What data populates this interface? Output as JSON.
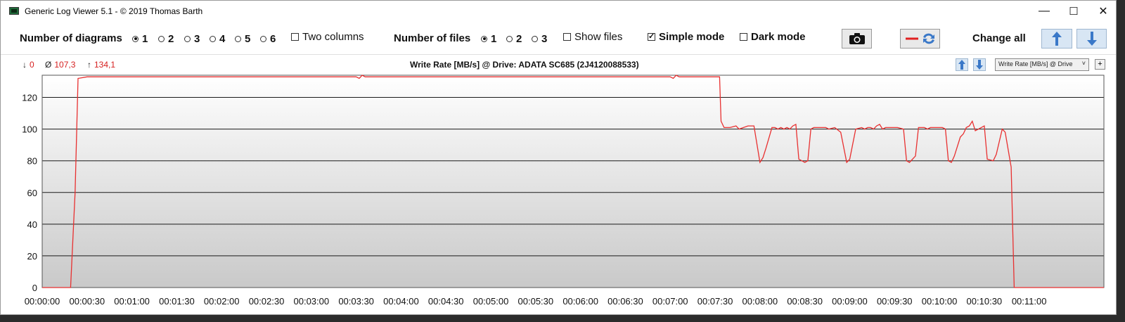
{
  "window": {
    "title": "Generic Log Viewer 5.1 - © 2019 Thomas Barth",
    "minimize_glyph": "—",
    "maximize_glyph": "☐",
    "close_glyph": "✕"
  },
  "toolbar": {
    "diagrams_label": "Number of diagrams",
    "diagram_options": [
      "1",
      "2",
      "3",
      "4",
      "5",
      "6"
    ],
    "diagram_selected": "1",
    "two_columns_label": "Two columns",
    "two_columns_checked": false,
    "files_label": "Number of files",
    "file_options": [
      "1",
      "2",
      "3"
    ],
    "file_selected": "1",
    "show_files_label": "Show files",
    "show_files_checked": false,
    "simple_mode_label": "Simple mode",
    "simple_mode_checked": true,
    "dark_mode_label": "Dark mode",
    "dark_mode_checked": false,
    "check_glyph": "✓",
    "change_all_label": "Change all",
    "icons": {
      "screenshot": "camera-icon",
      "swap": "swap-line-color-icon",
      "up": "arrow-up-icon",
      "down": "arrow-down-icon"
    },
    "accent_red": "#e02020",
    "accent_blue": "#3a78c8"
  },
  "chart_header": {
    "min_symbol": "↓",
    "min_value": "0",
    "avg_symbol": "Ø",
    "avg_value": "107,3",
    "max_symbol": "↑",
    "max_value": "134,1",
    "title": "Write Rate [MB/s] @ Drive: ADATA SC685 (2J4120088533)",
    "series_select_value": "Write Rate [MB/s] @ Drive",
    "series_select_chevron": "˅",
    "add_button": "+"
  },
  "chart_data": {
    "type": "line",
    "title": "Write Rate [MB/s] @ Drive: ADATA SC685 (2J4120088533)",
    "xlabel": "",
    "ylabel": "",
    "ylim": [
      0,
      134
    ],
    "xlim_seconds": [
      0,
      710
    ],
    "grid": true,
    "y_ticks": [
      0,
      20,
      40,
      60,
      80,
      100,
      120
    ],
    "x_ticks": [
      "00:00:00",
      "00:00:30",
      "00:01:00",
      "00:01:30",
      "00:02:00",
      "00:02:30",
      "00:03:00",
      "00:03:30",
      "00:04:00",
      "00:04:30",
      "00:05:00",
      "00:05:30",
      "00:06:00",
      "00:06:30",
      "00:07:00",
      "00:07:30",
      "00:08:00",
      "00:08:30",
      "00:09:00",
      "00:09:30",
      "00:10:00",
      "00:10:30",
      "00:11:00"
    ],
    "line_color": "#e83030",
    "series": [
      {
        "x": [
          0,
          19,
          22,
          24,
          30,
          200,
          210,
          212,
          214,
          216,
          400,
          420,
          422,
          424,
          426,
          453,
          454,
          456,
          460,
          464,
          466,
          472,
          476,
          480,
          482,
          484,
          488,
          490,
          492,
          494,
          496,
          498,
          500,
          502,
          504,
          506,
          510,
          512,
          514,
          516,
          520,
          524,
          526,
          530,
          534,
          538,
          540,
          544,
          548,
          550,
          552,
          554,
          556,
          558,
          560,
          562,
          564,
          566,
          568,
          572,
          576,
          578,
          580,
          584,
          586,
          590,
          592,
          594,
          596,
          598,
          600,
          602,
          604,
          606,
          608,
          610,
          614,
          616,
          618,
          620,
          622,
          624,
          628,
          630,
          632,
          636,
          638,
          642,
          644,
          648,
          650,
          652,
          654,
          660,
          670,
          700,
          710
        ],
        "y": [
          0,
          0,
          60,
          132,
          133,
          133,
          133,
          132,
          134,
          133,
          133,
          133,
          132,
          134,
          133,
          133,
          105,
          101,
          101,
          102,
          100,
          102,
          102,
          79,
          82,
          88,
          101,
          101,
          100,
          101,
          100,
          101,
          100,
          102,
          103,
          81,
          79,
          80,
          100,
          101,
          101,
          101,
          100,
          101,
          98,
          79,
          81,
          100,
          101,
          100,
          101,
          101,
          100,
          102,
          103,
          100,
          101,
          101,
          101,
          101,
          100,
          80,
          79,
          83,
          101,
          101,
          100,
          101,
          101,
          101,
          101,
          101,
          100,
          80,
          79,
          83,
          95,
          97,
          101,
          102,
          105,
          99,
          101,
          102,
          81,
          80,
          84,
          100,
          98,
          76,
          0,
          0,
          0,
          0,
          0,
          0,
          0
        ]
      }
    ]
  }
}
